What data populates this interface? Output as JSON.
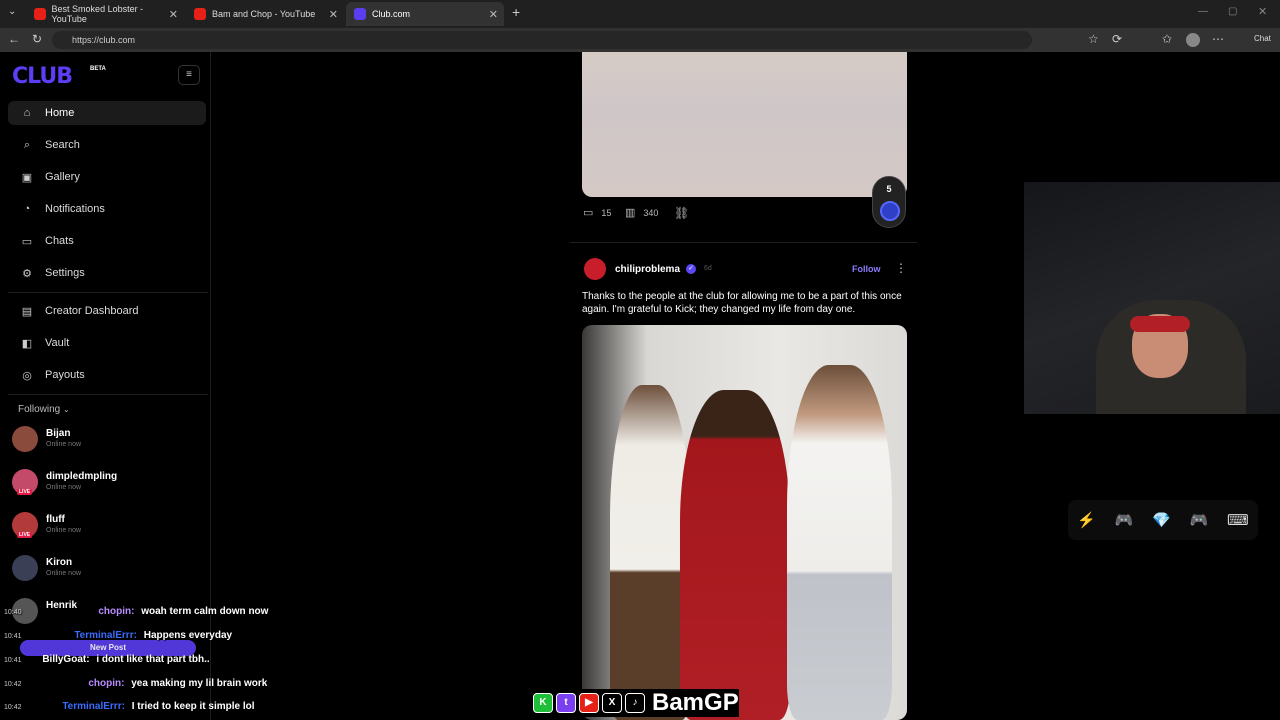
{
  "browser": {
    "tabs": [
      {
        "title": "Best Smoked Lobster - YouTube",
        "fav_color": "#e62117"
      },
      {
        "title": "Bam and Chop - YouTube",
        "fav_color": "#e62117"
      },
      {
        "title": "Club.com",
        "fav_color": "#5b3df0"
      }
    ],
    "url": "https://club.com",
    "chat_label": "Chat"
  },
  "sidebar": {
    "logo": "CLUB",
    "beta": "BETA",
    "nav": [
      {
        "label": "Home",
        "icon": "home-icon",
        "glyph": "⌂"
      },
      {
        "label": "Search",
        "icon": "search-icon",
        "glyph": "⌕"
      },
      {
        "label": "Gallery",
        "icon": "gallery-icon",
        "glyph": "▣"
      },
      {
        "label": "Notifications",
        "icon": "bell-icon",
        "glyph": "◔"
      },
      {
        "label": "Chats",
        "icon": "chat-icon",
        "glyph": "▭"
      },
      {
        "label": "Settings",
        "icon": "gear-icon",
        "glyph": "⚙"
      },
      {
        "label": "Creator Dashboard",
        "icon": "dashboard-icon",
        "glyph": "▤"
      },
      {
        "label": "Vault",
        "icon": "vault-icon",
        "glyph": "◧"
      },
      {
        "label": "Payouts",
        "icon": "payout-icon",
        "glyph": "◎"
      }
    ],
    "following_label": "Following",
    "following": [
      {
        "name": "Bijan",
        "status": "Online now",
        "live": false,
        "color": "#8a4b3c"
      },
      {
        "name": "dimpledmpling",
        "status": "Online now",
        "live": true,
        "color": "#c44a6a"
      },
      {
        "name": "fluff",
        "status": "Online now",
        "live": true,
        "color": "#b23a3a"
      },
      {
        "name": "Kiron",
        "status": "Online now",
        "live": false,
        "color": "#3a3f55"
      },
      {
        "name": "Henrik",
        "status": "",
        "live": false,
        "color": "#555"
      }
    ],
    "new_post": "New Post"
  },
  "feed": {
    "prev_post": {
      "comments": "15",
      "views": "340",
      "badge": "5"
    },
    "post": {
      "author": "chiliproblema",
      "time": "6d",
      "follow": "Follow",
      "text": "Thanks to the people at the club for allowing me to be a part of this once again. I'm grateful to Kick; they changed my life from day one."
    }
  },
  "chat": [
    {
      "time": "10:40",
      "user": "chopin:",
      "msg": "woah term calm down now",
      "color": "#b98cff"
    },
    {
      "time": "10:41",
      "user": "TerminalErrr:",
      "msg": "Happens everyday",
      "color": "#3b6cff"
    },
    {
      "time": "10:41",
      "user": "BillyGoat:",
      "msg": "i dont like that part tbh..",
      "color": "#ffffff"
    },
    {
      "time": "10:42",
      "user": "chopin:",
      "msg": "yea making my lil brain work",
      "color": "#b98cff"
    },
    {
      "time": "10:42",
      "user": "TerminalErrr:",
      "msg": "I tried to keep it simple lol",
      "color": "#3b6cff"
    }
  ],
  "overlay": {
    "brand": "BamGP"
  }
}
